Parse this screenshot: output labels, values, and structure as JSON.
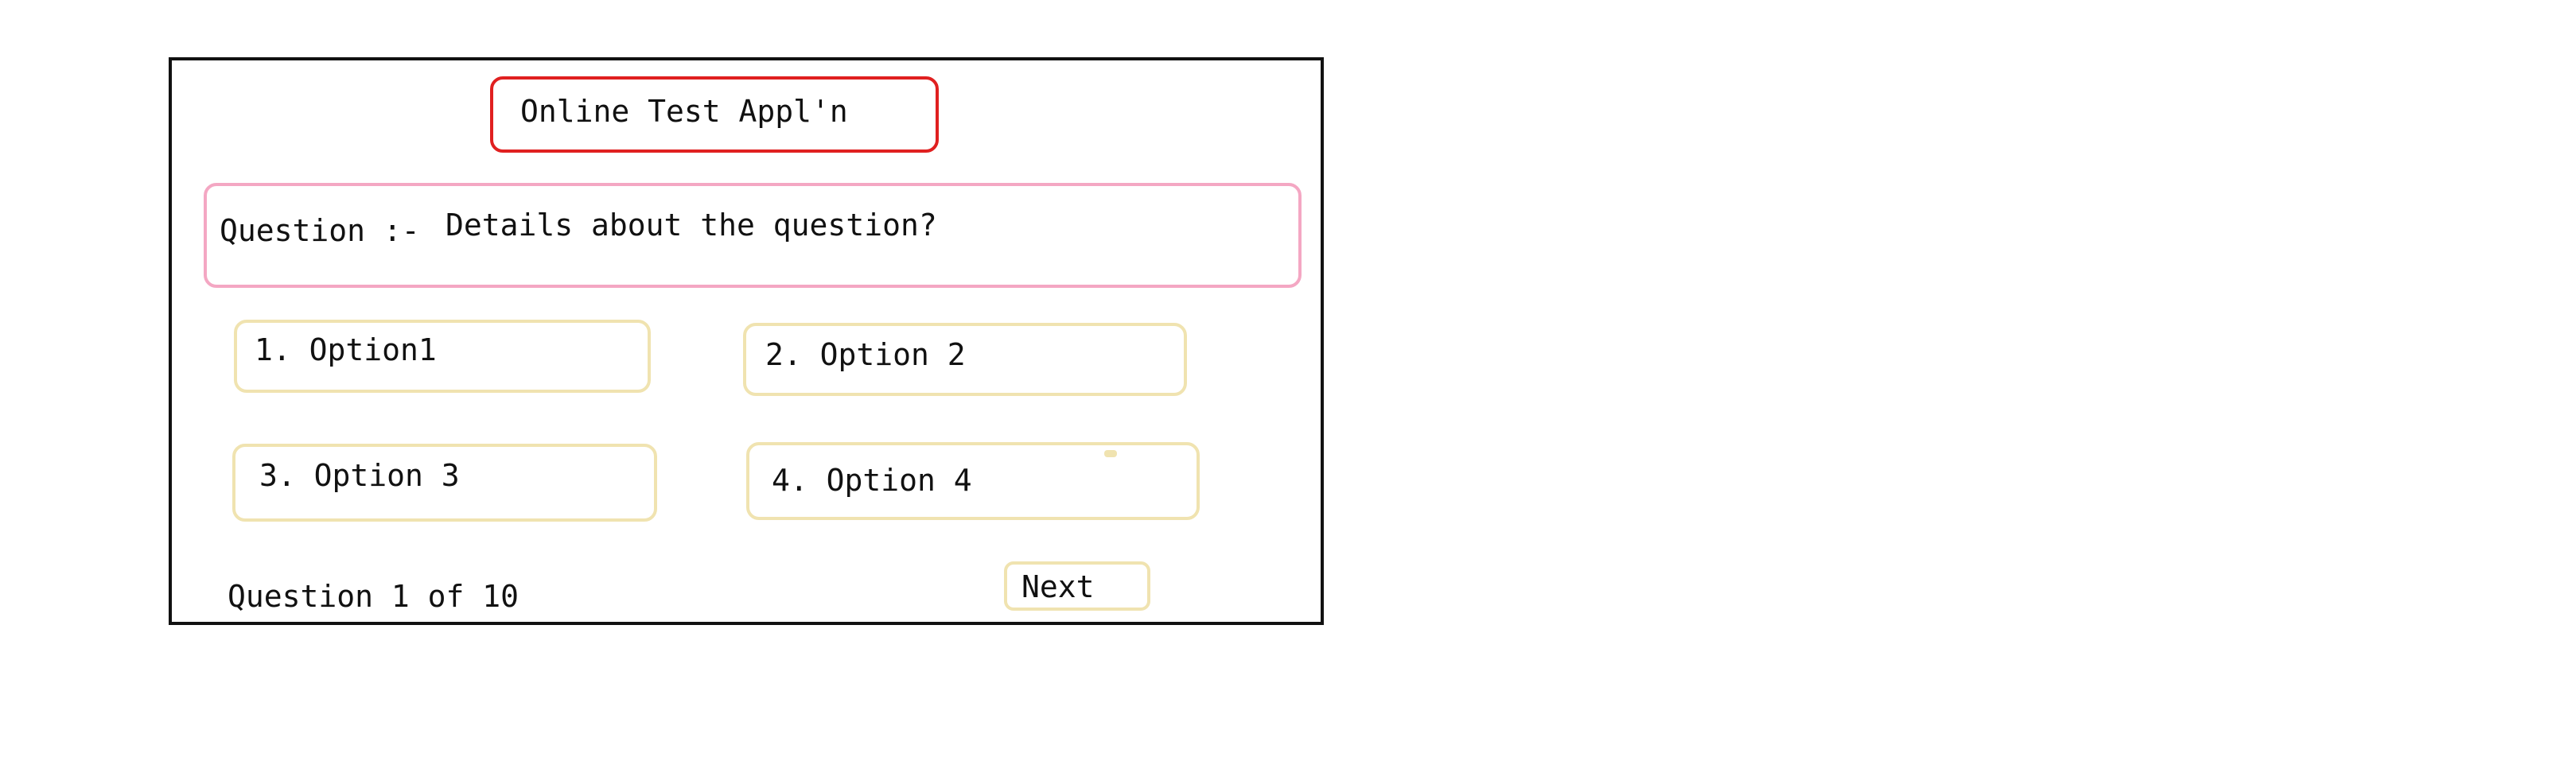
{
  "app": {
    "title": "Online Test Appl'n"
  },
  "question": {
    "label": "Question :-",
    "text": "Details about the question?"
  },
  "options": [
    {
      "label": "1. Option1"
    },
    {
      "label": "2. Option 2"
    },
    {
      "label": "3. Option 3"
    },
    {
      "label": "4. Option 4"
    }
  ],
  "footer": {
    "progress": "Question 1 of 10",
    "next_label": "Next"
  },
  "colors": {
    "title_border": "#e02020",
    "question_border": "#f4a7c3",
    "option_border": "#f0e3b0",
    "frame_border": "#111111"
  }
}
